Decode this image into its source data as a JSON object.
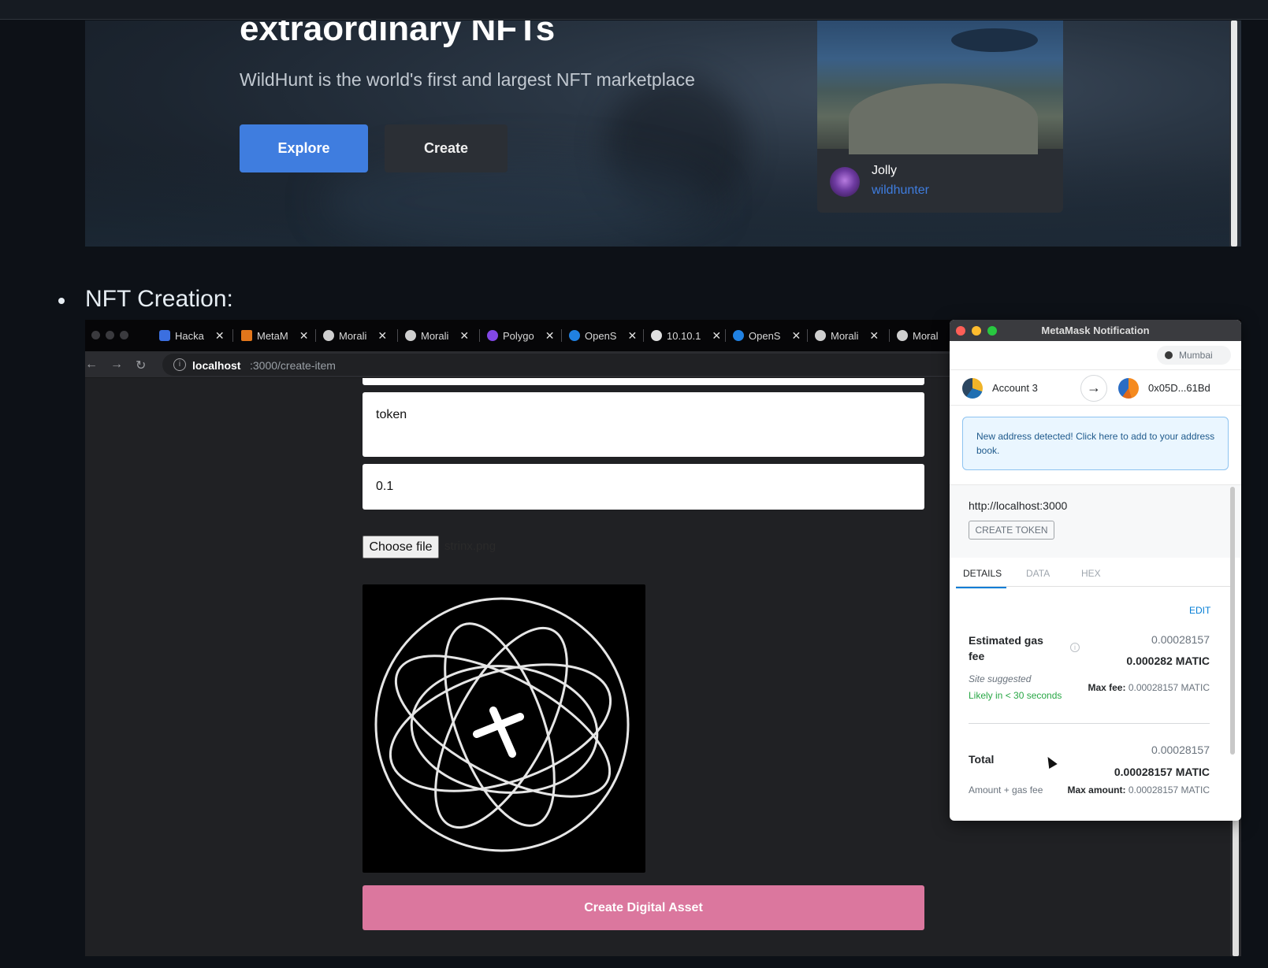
{
  "hero": {
    "title": "extraordinary NFTs",
    "subtitle": "WildHunt is the world's first and largest NFT marketplace",
    "explore_label": "Explore",
    "create_label": "Create",
    "card": {
      "name": "Jolly",
      "username": "wildhunter"
    }
  },
  "section": {
    "bullet": "NFT Creation:"
  },
  "browser": {
    "tabs": [
      {
        "label": "Hacka",
        "icon": "hackathon-icon"
      },
      {
        "label": "MetaM",
        "icon": "metamask-fox-icon"
      },
      {
        "label": "Morali",
        "icon": "moralis-icon"
      },
      {
        "label": "Morali",
        "icon": "moralis-icon"
      },
      {
        "label": "Polygo",
        "icon": "polygon-icon"
      },
      {
        "label": "OpenS",
        "icon": "opensea-icon"
      },
      {
        "label": "10.10.1",
        "icon": "globe-icon"
      },
      {
        "label": "OpenS",
        "icon": "opensea-icon"
      },
      {
        "label": "Morali",
        "icon": "moralis-icon"
      },
      {
        "label": "Moral",
        "icon": "moralis-icon"
      }
    ],
    "url_host": "localhost",
    "url_path": ":3000/create-item"
  },
  "form": {
    "description_value": "token",
    "price_value": "0.1",
    "choose_file_label": "Choose file",
    "file_name": "strinx.png",
    "submit_label": "Create Digital Asset"
  },
  "metamask": {
    "window_title": "MetaMask Notification",
    "network": "Mumbai",
    "from_account": "Account 3",
    "to_address": "0x05D...61Bd",
    "notice": "New address detected! Click here to add to your address book.",
    "origin": "http://localhost:3000",
    "method": "CREATE TOKEN",
    "tabs": [
      "DETAILS",
      "DATA",
      "HEX"
    ],
    "edit_label": "EDIT",
    "gas_label": "Estimated gas fee",
    "gas_value_secondary": "0.00028157",
    "gas_value_primary": "0.000282 MATIC",
    "site_suggested": "Site suggested",
    "likely": "Likely in < 30 seconds",
    "max_fee_label": "Max fee:",
    "max_fee_value": "0.00028157 MATIC",
    "total_label": "Total",
    "total_value_secondary": "0.00028157",
    "total_value_primary": "0.00028157 MATIC",
    "amount_gas": "Amount + gas fee",
    "max_amount_label": "Max amount:",
    "max_amount_value": "0.00028157 MATIC"
  },
  "colors": {
    "explore_blue": "#3f7ddf",
    "submit_pink": "#db779e",
    "metamask_link": "#037dd6",
    "likely_green": "#28a745"
  }
}
